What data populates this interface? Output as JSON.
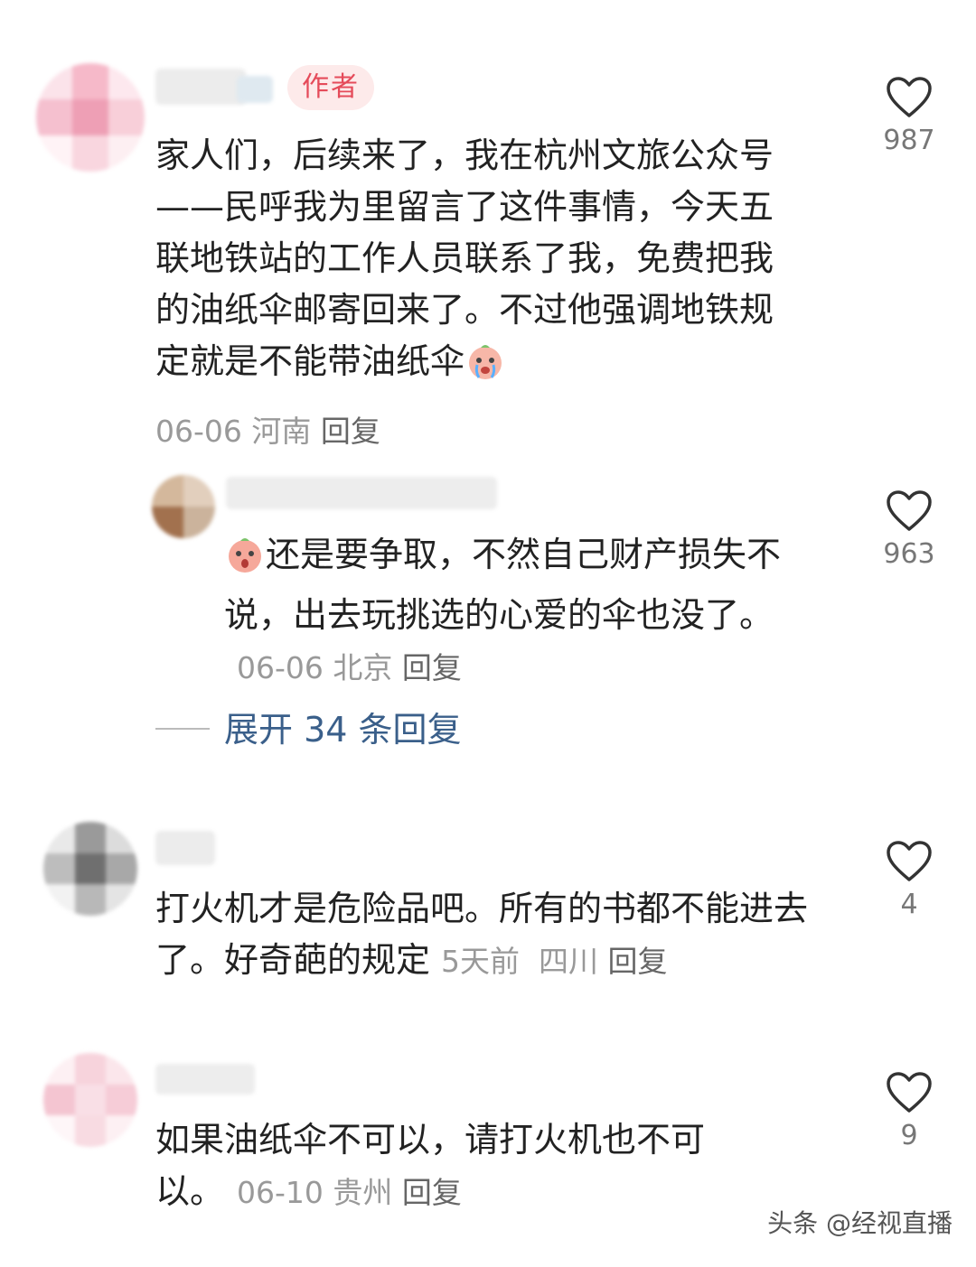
{
  "comments": [
    {
      "badge": "作者",
      "text": "家人们，后续来了，我在杭州文旅公众号——民呼我为里留言了这件事情，今天五联地铁站的工作人员联系了我，免费把我的油纸伞邮寄回来了。不过他强调地铁规定就是不能带油纸伞",
      "date": "06-06",
      "location": "河南",
      "reply_label": "回复",
      "likes": "987",
      "emoji": "crying-peach-emoji"
    },
    {
      "text": "还是要争取，不然自己财产损失不说，出去玩挑选的心爱的伞也没了。",
      "date": "06-06",
      "location": "北京",
      "reply_label": "回复",
      "likes": "963",
      "emoji": "shocked-peach-emoji"
    },
    {
      "text": "打火机才是危险品吧。所有的书都不能进去了。好奇葩的规定",
      "date": "5天前",
      "location": "四川",
      "reply_label": "回复",
      "likes": "4"
    },
    {
      "text": "如果油纸伞不可以，请打火机也不可以。",
      "date": "06-10",
      "location": "贵州",
      "reply_label": "回复",
      "likes": "9"
    }
  ],
  "expand_replies": "展开 34 条回复",
  "watermark": "头条 @经视直播",
  "colors": {
    "badge_bg": "#fdeaea",
    "badge_text": "#e54b5a",
    "expand_link": "#3a5f8a",
    "meta": "#999999"
  }
}
